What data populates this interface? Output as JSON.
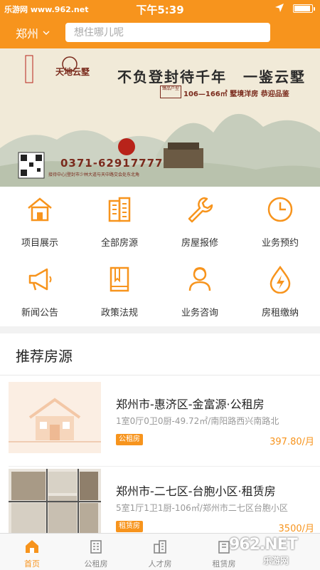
{
  "status": {
    "site": "乐游网 www.962.net",
    "time": "下午5:39"
  },
  "header": {
    "city": "郑州",
    "search_placeholder": "想住哪儿呢"
  },
  "banner": {
    "brand": "天地云墅",
    "slogan_a": "不负登封待千年",
    "slogan_b": "一鉴云墅",
    "tag": "臻品户型",
    "area": "106—166㎡ 墅境洋房 恭迎品鉴",
    "phone": "0371-62917777",
    "address": "接待中心|登封市少林大道与天中路交会处东北角"
  },
  "grid": [
    {
      "label": "项目展示",
      "icon": "house-icon"
    },
    {
      "label": "全部房源",
      "icon": "building-icon"
    },
    {
      "label": "房屋报修",
      "icon": "wrench-icon"
    },
    {
      "label": "业务预约",
      "icon": "clock-icon"
    },
    {
      "label": "新闻公告",
      "icon": "megaphone-icon"
    },
    {
      "label": "政策法规",
      "icon": "book-icon"
    },
    {
      "label": "业务咨询",
      "icon": "person-icon"
    },
    {
      "label": "房租缴纳",
      "icon": "drop-bolt-icon"
    }
  ],
  "recommended": {
    "title": "推荐房源",
    "items": [
      {
        "name": "郑州市-惠济区-金富源·公租房",
        "desc": "1室0厅0卫0厨-49.72㎡/南阳路西兴南路北",
        "tag": "公租房",
        "price": "397.80/月"
      },
      {
        "name": "郑州市-二七区-台胞小区·租赁房",
        "desc": "5室1厅1卫1厨-106㎡/郑州市二七区台胞小区",
        "tag": "租赁房",
        "price": "3500/月"
      }
    ]
  },
  "tabbar": [
    {
      "label": "首页",
      "icon": "home-icon",
      "active": true
    },
    {
      "label": "公租房",
      "icon": "apartment-icon",
      "active": false
    },
    {
      "label": "人才房",
      "icon": "tower-icon",
      "active": false
    },
    {
      "label": "租赁房",
      "icon": "rental-icon",
      "active": false
    }
  ],
  "watermark": {
    "logo": "962.NET",
    "site": "乐游网"
  },
  "colors": {
    "accent": "#f7941d"
  }
}
